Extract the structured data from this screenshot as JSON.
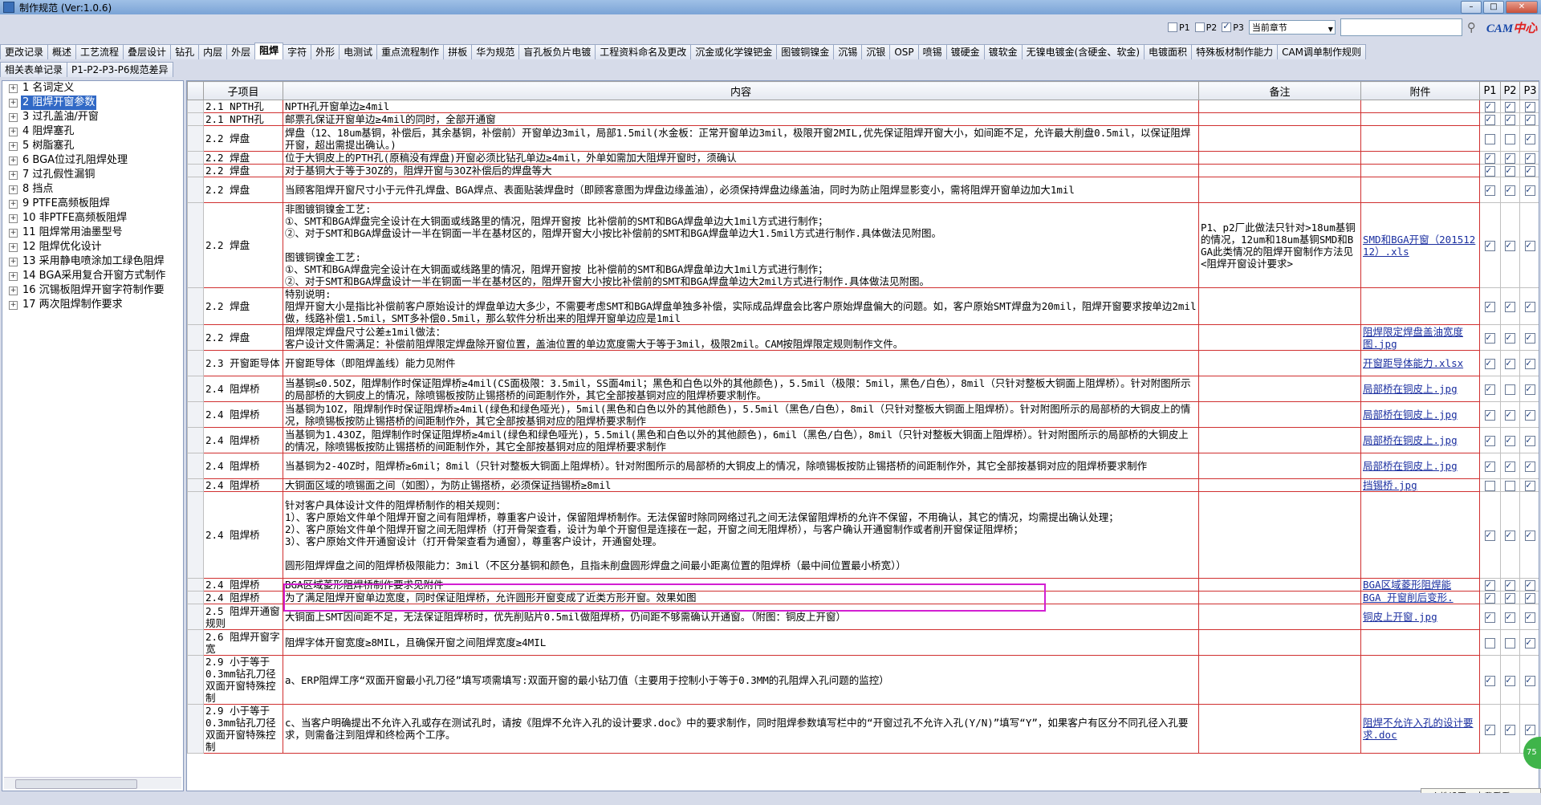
{
  "window": {
    "title": "制作规范 (Ver:1.0.6)"
  },
  "toolbar": {
    "p1_label": "P1",
    "p2_label": "P2",
    "p3_label": "P3",
    "p1_checked": false,
    "p2_checked": false,
    "p3_checked": true,
    "scope_select": "当前章节",
    "search_value": "",
    "logo_main": "CAM",
    "logo_accent": "中心"
  },
  "tabs": [
    "更改记录",
    "概述",
    "工艺流程",
    "叠层设计",
    "钻孔",
    "内层",
    "外层",
    "阻焊",
    "字符",
    "外形",
    "电测试",
    "重点流程制作",
    "拼板",
    "华为规范",
    "盲孔板负片电镀",
    "工程资料命名及更改",
    "沉金或化学镍钯金",
    "图镀铜镍金",
    "沉锡",
    "沉银",
    "OSP",
    "喷锡",
    "镀硬金",
    "镀软金",
    "无镍电镀金(含硬金、软金)",
    "电镀面积",
    "特殊板材制作能力",
    "CAM调单制作规则"
  ],
  "active_tab": "阻焊",
  "tabs_row2": [
    "相关表单记录",
    "P1-P2-P3-P6规范差异"
  ],
  "sidebar": {
    "items": [
      {
        "label": "1  名词定义",
        "selected": false
      },
      {
        "label": "2  阻焊开窗参数",
        "selected": true
      },
      {
        "label": "3  过孔盖油/开窗",
        "selected": false
      },
      {
        "label": "4  阻焊塞孔",
        "selected": false
      },
      {
        "label": "5  树脂塞孔",
        "selected": false
      },
      {
        "label": "6  BGA位过孔阻焊处理",
        "selected": false
      },
      {
        "label": "7  过孔假性漏铜",
        "selected": false
      },
      {
        "label": "8  挡点",
        "selected": false
      },
      {
        "label": "9  PTFE高频板阻焊",
        "selected": false
      },
      {
        "label": "10  非PTFE高频板阻焊",
        "selected": false
      },
      {
        "label": "11  阻焊常用油墨型号",
        "selected": false
      },
      {
        "label": "12  阻焊优化设计",
        "selected": false
      },
      {
        "label": "13  采用静电喷涂加工绿色阻焊",
        "selected": false
      },
      {
        "label": "14  BGA采用复合开窗方式制作",
        "selected": false
      },
      {
        "label": "16  沉锡板阻焊开窗字符制作要",
        "selected": false
      },
      {
        "label": "17  两次阻焊制作要求",
        "selected": false
      }
    ]
  },
  "table": {
    "headers": {
      "sub": "子项目",
      "content": "内容",
      "note": "备注",
      "attach": "附件",
      "p1": "P1",
      "p2": "P2",
      "p3": "P3"
    },
    "rows": [
      {
        "sub": "2.1 NPTH孔",
        "content": "NPTH孔开窗单边≥4mil",
        "note": "",
        "attach": "",
        "p1": true,
        "p2": true,
        "p3": true
      },
      {
        "sub": "2.1 NPTH孔",
        "content": "邮票孔保证开窗单边≥4mil的同时，全部开通窗",
        "note": "",
        "attach": "",
        "p1": true,
        "p2": true,
        "p3": true
      },
      {
        "sub": "2.2 焊盘",
        "content": "焊盘（12、18um基铜，补偿后，其余基铜，补偿前）开窗单边3mil，局部1.5mil(水金板：正常开窗单边3mil，极限开窗2MIL,优先保证阻焊开窗大小，如间距不足，允许最大削盘0.5mil，以保证阻焊开窗，超出需提出确认。)",
        "note": "",
        "attach": "",
        "p1": false,
        "p2": false,
        "p3": true
      },
      {
        "sub": "2.2 焊盘",
        "content": "位于大铜皮上的PTH孔(原稿没有焊盘)开窗必须比钻孔单边≥4mil，外单如需加大阻焊开窗时，须确认",
        "note": "",
        "attach": "",
        "p1": true,
        "p2": true,
        "p3": true
      },
      {
        "sub": "2.2 焊盘",
        "content": "对于基铜大于等于3OZ的，阻焊开窗与3OZ补偿后的焊盘等大",
        "note": "",
        "attach": "",
        "p1": true,
        "p2": true,
        "p3": true
      },
      {
        "sub": "2.2 焊盘",
        "content": "当顾客阻焊开窗尺寸小于元件孔焊盘、BGA焊点、表面贴装焊盘时（即顾客意图为焊盘边缘盖油），必须保持焊盘边缘盖油，同时为防止阻焊显影变小，需将阻焊开窗单边加大1mil",
        "note": "",
        "attach": "",
        "p1": true,
        "p2": true,
        "p3": true
      },
      {
        "sub": "2.2 焊盘",
        "content": "非图镀铜镍金工艺:\n①、SMT和BGA焊盘完全设计在大铜面或线路里的情况，阻焊开窗按 比补偿前的SMT和BGA焊盘单边大1mil方式进行制作；\n②、对于SMT和BGA焊盘设计一半在铜面一半在基材区的，阻焊开窗大小按比补偿前的SMT和BGA焊盘单边大1.5mil方式进行制作.具体做法见附图。\n\n图镀铜镍金工艺:\n①、SMT和BGA焊盘完全设计在大铜面或线路里的情况，阻焊开窗按 比补偿前的SMT和BGA焊盘单边大1mil方式进行制作；\n②、对于SMT和BGA焊盘设计一半在铜面一半在基材区的，阻焊开窗大小按比补偿前的SMT和BGA焊盘单边大2mil方式进行制作.具体做法见附图。",
        "note": "P1、p2厂此做法只针对>18um基铜的情况，12um和18um基铜SMD和BGA此类情况的阻焊开窗制作方法见<阻焊开窗设计要求>",
        "attach": "SMD和BGA开窗（20151212）.xls",
        "p1": true,
        "p2": true,
        "p3": true
      },
      {
        "sub": "2.2 焊盘",
        "content": "特别说明:\n阻焊开窗大小是指比补偿前客户原始设计的焊盘单边大多少，不需要考虑SMT和BGA焊盘单独多补偿，实际成品焊盘会比客户原始焊盘偏大的问题。如，客户原始SMT焊盘为20mil，阻焊开窗要求按单边2mil做，线路补偿1.5mil，SMT多补偿0.5mil，那么软件分析出来的阻焊开窗单边应是1mil",
        "note": "",
        "attach": "",
        "p1": true,
        "p2": true,
        "p3": true
      },
      {
        "sub": "2.2 焊盘",
        "content": "阻焊限定焊盘尺寸公差±1mil做法：\n客户设计文件需满足：补偿前阻焊限定焊盘除开窗位置，盖油位置的单边宽度需大于等于3mil，极限2mil。CAM按阻焊限定规则制作文件。",
        "note": "",
        "attach": "阻焊限定焊盘盖油宽度图.jpg",
        "p1": true,
        "p2": true,
        "p3": true
      },
      {
        "sub": "2.3 开窗距导体",
        "content": "开窗距导体（即阻焊盖线）能力见附件",
        "note": "",
        "attach": "开窗距导体能力.xlsx",
        "p1": true,
        "p2": true,
        "p3": true
      },
      {
        "sub": "2.4 阻焊桥",
        "content": "当基铜≤0.5OZ，阻焊制作时保证阻焊桥≥4mil(CS面极限：3.5mil，SS面4mil；黑色和白色以外的其他颜色)，5.5mil（极限：5mil，黑色/白色），8mil（只针对整板大铜面上阻焊桥）。针对附图所示的局部桥的大铜皮上的情况，除喷锡板按防止锡搭桥的间距制作外，其它全部按基铜对应的阻焊桥要求制作。",
        "note": "",
        "attach": "局部桥在铜皮上.jpg",
        "p1": true,
        "p2": false,
        "p3": true
      },
      {
        "sub": "2.4 阻焊桥",
        "content": "当基铜为1OZ，阻焊制作时保证阻焊桥≥4mil(绿色和绿色哑光)，5mil(黑色和白色以外的其他颜色)，5.5mil（黑色/白色），8mil（只针对整板大铜面上阻焊桥）。针对附图所示的局部桥的大铜皮上的情况，除喷锡板按防止锡搭桥的间距制作外，其它全部按基铜对应的阻焊桥要求制作",
        "note": "",
        "attach": "局部桥在铜皮上.jpg",
        "p1": true,
        "p2": true,
        "p3": true
      },
      {
        "sub": "2.4 阻焊桥",
        "content": "当基铜为1.43OZ，阻焊制作时保证阻焊桥≥4mil(绿色和绿色哑光)，5.5mil(黑色和白色以外的其他颜色)，6mil（黑色/白色），8mil（只针对整板大铜面上阻焊桥）。针对附图所示的局部桥的大铜皮上的情况，除喷锡板按防止锡搭桥的间距制作外，其它全部按基铜对应的阻焊桥要求制作",
        "note": "",
        "attach": "局部桥在铜皮上.jpg",
        "p1": true,
        "p2": true,
        "p3": true
      },
      {
        "sub": "2.4 阻焊桥",
        "content": "当基铜为2-4OZ时，阻焊桥≥6mil；8mil（只针对整板大铜面上阻焊桥）。针对附图所示的局部桥的大铜皮上的情况，除喷锡板按防止锡搭桥的间距制作外，其它全部按基铜对应的阻焊桥要求制作",
        "note": "",
        "attach": "局部桥在铜皮上.jpg",
        "p1": true,
        "p2": true,
        "p3": true
      },
      {
        "sub": "2.4 阻焊桥",
        "content": "大铜面区域的喷锡面之间（如图），为防止锡搭桥，必须保证挡锡桥≥8mil",
        "note": "",
        "attach": "挡锡桥.jpg",
        "p1": false,
        "p2": false,
        "p3": true
      },
      {
        "sub": "2.4 阻焊桥",
        "content": "针对客户具体设计文件的阻焊桥制作的相关规则：\n1）、客户原始文件单个阻焊开窗之间有阻焊桥，尊重客户设计，保留阻焊桥制作。无法保留时除同网络过孔之间无法保留阻焊桥的允许不保留，不用确认，其它的情况，均需提出确认处理；\n2）、客户原始文件单个阻焊开窗之间无阻焊桥（打开骨架查看，设计为单个开窗但是连接在一起，开窗之间无阻焊桥），与客户确认开通窗制作或者削开窗保证阻焊桥；\n3）、客户原始文件开通窗设计（打开骨架查看为通窗），尊重客户设计，开通窗处理。\n\n圆形阻焊焊盘之间的阻焊桥极限能力：3mil（不区分基铜和颜色，且指未削盘圆形焊盘之间最小距离位置的阻焊桥（最中间位置最小桥宽））",
        "note": "",
        "attach": "",
        "p1": true,
        "p2": true,
        "p3": true
      },
      {
        "sub": "2.4 阻焊桥",
        "content": "BGA区域菱形阻焊桥制作要求见附件",
        "note": "",
        "attach": "BGA区域菱形阻焊能",
        "p1": true,
        "p2": true,
        "p3": true
      },
      {
        "sub": "2.4 阻焊桥",
        "content": "为了满足阻焊开窗单边宽度，同时保证阻焊桥，允许圆形开窗变成了近类方形开窗。效果如图",
        "note": "",
        "attach": "BGA 开窗削后变形.",
        "p1": true,
        "p2": true,
        "p3": true
      },
      {
        "sub": "2.5 阻焊开通窗规则",
        "content": "大铜面上SMT因间距不足，无法保证阻焊桥时，优先削贴片0.5mil做阻焊桥，仍间距不够需确认开通窗。（附图：铜皮上开窗）",
        "note": "",
        "attach": "铜皮上开窗.jpg",
        "p1": true,
        "p2": true,
        "p3": true
      },
      {
        "sub": "2.6 阻焊开窗字宽",
        "content": "阻焊字体开窗宽度≥8MIL，且确保开窗之间阻焊宽度≥4MIL",
        "note": "",
        "attach": "",
        "p1": false,
        "p2": false,
        "p3": true
      },
      {
        "sub": "2.9 小于等于0.3mm钻孔刀径双面开窗特殊控制",
        "content": "a、ERP阻焊工序“双面开窗最小孔刀径”填写项需填写:双面开窗的最小钻刀值（主要用于控制小于等于0.3MM的孔阻焊入孔问题的监控）",
        "note": "",
        "attach": "",
        "p1": true,
        "p2": true,
        "p3": true
      },
      {
        "sub": "2.9 小于等于0.3mm钻孔刀径双面开窗特殊控制",
        "content": "c、当客户明确提出不允许入孔或存在测试孔时，请按《阻焊不允许入孔的设计要求.doc》中的要求制作，同时阻焊参数填写栏中的“开窗过孔不允许入孔(Y/N)”填写“Y”，如果客户有区分不同孔径入孔要求，则需备注到阻焊和终检两个工序。",
        "note": "",
        "attach": "阻焊不允许入孔的设计要求.doc",
        "p1": true,
        "p2": true,
        "p3": true
      }
    ]
  },
  "tooltip": "个性设置，点我看看",
  "badge": "75"
}
